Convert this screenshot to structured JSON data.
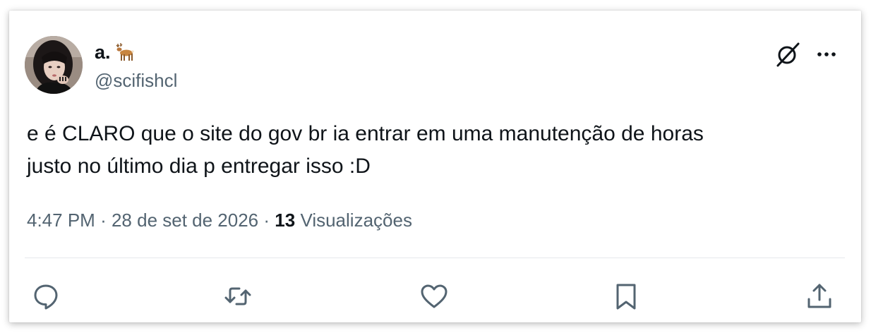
{
  "author": {
    "display_name": "a.",
    "emoji_icon": "deer-icon",
    "handle": "@scifishcl",
    "avatar_icon": "avatar-photo"
  },
  "header_actions": {
    "grok_icon": "grok-icon",
    "more_icon": "more-dots-icon"
  },
  "tweet": {
    "text_line_1": "e é CLARO que o site do gov br ia entrar em uma manutenção de horas",
    "text_line_2": "justo no último dia p entregar isso :D"
  },
  "meta": {
    "time": "4:47 PM",
    "separator": "·",
    "date": "28 de set de 2026",
    "views_count": "13",
    "views_label": "Visualizações"
  },
  "actions": [
    {
      "icon": "reply-icon"
    },
    {
      "icon": "retweet-icon"
    },
    {
      "icon": "like-icon"
    },
    {
      "icon": "bookmark-icon"
    },
    {
      "icon": "share-icon"
    }
  ],
  "colors": {
    "text_primary": "#0f1419",
    "text_secondary": "#536471",
    "divider": "#e6e9eb"
  }
}
